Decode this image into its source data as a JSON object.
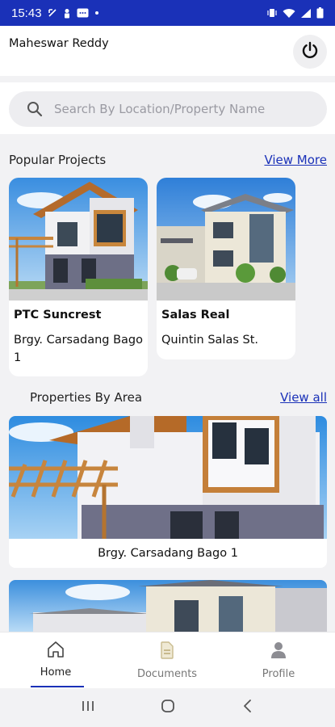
{
  "status_bar": {
    "time": "15:43",
    "bg_color": "#1a31b8"
  },
  "header": {
    "user_name": "Maheswar Reddy"
  },
  "search": {
    "placeholder": "Search By Location/Property Name"
  },
  "popular_projects": {
    "title": "Popular Projects",
    "view_more": "View More",
    "items": [
      {
        "name": "PTC Suncrest",
        "location": "Brgy. Carsadang Bago 1"
      },
      {
        "name": "Salas Real",
        "location": "Quintin Salas St."
      }
    ]
  },
  "properties_by_area": {
    "title": "Properties By Area",
    "view_all": "View all",
    "items": [
      {
        "label": "Brgy. Carsadang Bago 1"
      }
    ]
  },
  "bottom_nav": {
    "items": [
      {
        "label": "Home",
        "icon": "home-icon",
        "active": true
      },
      {
        "label": "Documents",
        "icon": "document-icon",
        "active": false
      },
      {
        "label": "Profile",
        "icon": "person-icon",
        "active": false
      }
    ]
  },
  "colors": {
    "accent": "#1a31b8",
    "background": "#f2f2f4"
  }
}
